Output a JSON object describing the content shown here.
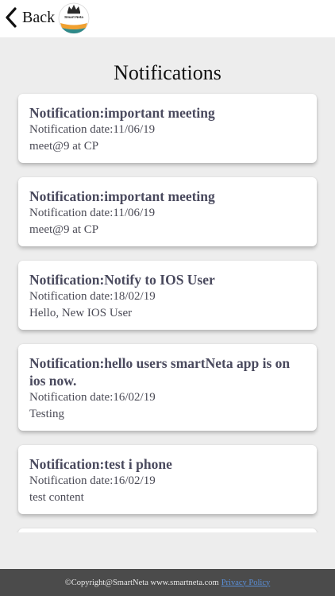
{
  "header": {
    "back_label": "Back",
    "logo_text": "Smart Neta"
  },
  "page": {
    "title": "Notifications"
  },
  "notifications": [
    {
      "title": "Notification:important meeting",
      "date": "Notification date:11/06/19",
      "body": "meet@9 at CP"
    },
    {
      "title": "Notification:important meeting",
      "date": "Notification date:11/06/19",
      "body": "meet@9 at CP"
    },
    {
      "title": "Notification:Notify to IOS User",
      "date": "Notification date:18/02/19",
      "body": "Hello, New IOS User"
    },
    {
      "title": "Notification:hello users smartNeta app is on ios now.",
      "date": "Notification date:16/02/19",
      "body": "Testing"
    },
    {
      "title": "Notification:test i phone",
      "date": "Notification date:16/02/19",
      "body": "test content"
    }
  ],
  "footer": {
    "copyright": "©Copyright@SmartNeta www.smartneta.com",
    "privacy_link": "Privacy Policy"
  },
  "colors": {
    "page_bg": "#ededed",
    "footer_bg": "#4b4b4b",
    "title_text": "#4a4a5e",
    "link": "#5a8fd8"
  }
}
